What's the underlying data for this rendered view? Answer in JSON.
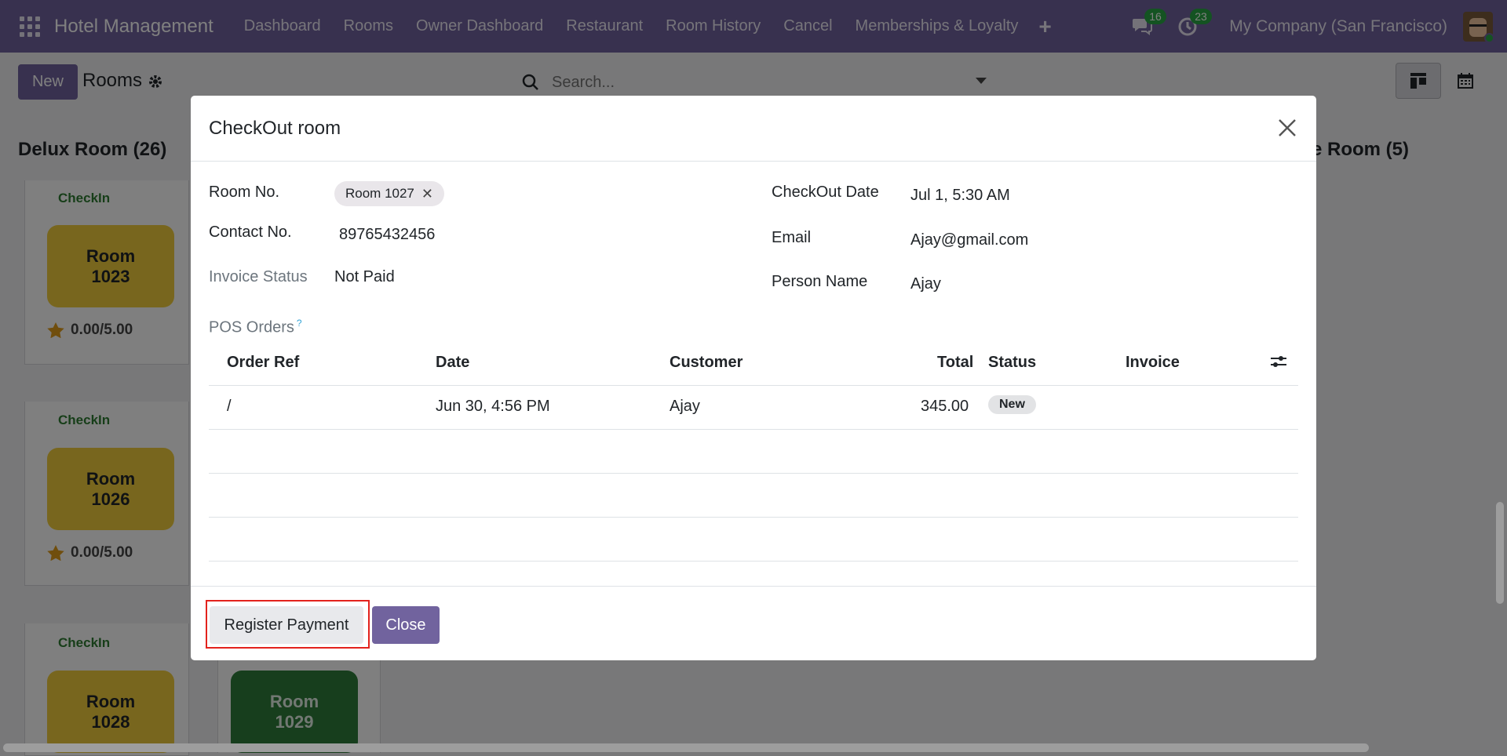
{
  "topnav": {
    "brand": "Hotel Management",
    "menu": [
      "Dashboard",
      "Rooms",
      "Owner Dashboard",
      "Restaurant",
      "Room History",
      "Cancel",
      "Memberships & Loyalty"
    ],
    "messages_count": "16",
    "activities_count": "23",
    "company": "My Company (San Francisco)"
  },
  "control": {
    "new_label": "New",
    "title": "Rooms",
    "search_placeholder": "Search..."
  },
  "kanban": {
    "column1_title": "Delux Room (26)",
    "column2_title_fragment": "e Room (5)",
    "cards": [
      {
        "status": "CheckIn",
        "room_line1": "Room",
        "room_line2": "1023",
        "rating": "0.00/5.00"
      },
      {
        "status": "CheckIn",
        "room_line1": "Room",
        "room_line2": "1026",
        "rating": "0.00/5.00"
      },
      {
        "status": "CheckIn",
        "room_line1": "Room",
        "room_line2": "1028"
      }
    ],
    "extra_tile": {
      "room_line1": "Room",
      "room_line2": "1029"
    }
  },
  "modal": {
    "title": "CheckOut room",
    "room_no_label": "Room No.",
    "room_no_tag": "Room 1027",
    "contact_label": "Contact No.",
    "contact_value": "89765432456",
    "invoice_status_label": "Invoice Status",
    "invoice_status_value": "Not Paid",
    "checkout_date_label": "CheckOut Date",
    "checkout_date_value": "Jul 1, 5:30 AM",
    "email_label": "Email",
    "email_value": "Ajay@gmail.com",
    "person_name_label": "Person Name",
    "person_name_value": "Ajay",
    "pos_orders_label": "POS Orders",
    "pos_help": "?",
    "table": {
      "headers": [
        "Order Ref",
        "Date",
        "Customer",
        "Total",
        "Status",
        "Invoice"
      ],
      "rows": [
        {
          "order_ref": "/",
          "date": "Jun 30, 4:56 PM",
          "customer": "Ajay",
          "total": "345.00",
          "status": "New"
        }
      ]
    },
    "register_payment_label": "Register Payment",
    "close_label": "Close"
  },
  "colors": {
    "brand": "#71639e",
    "highlight": "#e3221d",
    "checkin_text": "#2e7d32",
    "tile_yellow": "#f0cd3c",
    "tile_green": "#2e7d3a"
  }
}
